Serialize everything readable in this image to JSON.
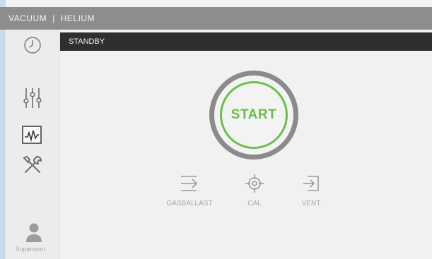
{
  "header": {
    "tab_vacuum": "VACUUM",
    "separator": "|",
    "tab_helium": "HELIUM"
  },
  "status": {
    "text": "STANDBY"
  },
  "start_button": {
    "label": "START"
  },
  "actions": [
    {
      "label": "GASBALLAST",
      "icon": "gasballast-icon"
    },
    {
      "label": "CAL",
      "icon": "crosshair-icon"
    },
    {
      "label": "VENT",
      "icon": "vent-icon"
    }
  ],
  "sidebar": {
    "items": [
      {
        "icon": "clock-icon"
      },
      {
        "icon": "sliders-icon"
      },
      {
        "icon": "chart-icon"
      },
      {
        "icon": "tools-icon"
      }
    ],
    "user_label": "Supervisor"
  },
  "colors": {
    "header_bg": "#8d8d8d",
    "status_bg": "#2f2f2f",
    "start_green": "#66bd45",
    "ring_gray": "#8b8b8b"
  }
}
